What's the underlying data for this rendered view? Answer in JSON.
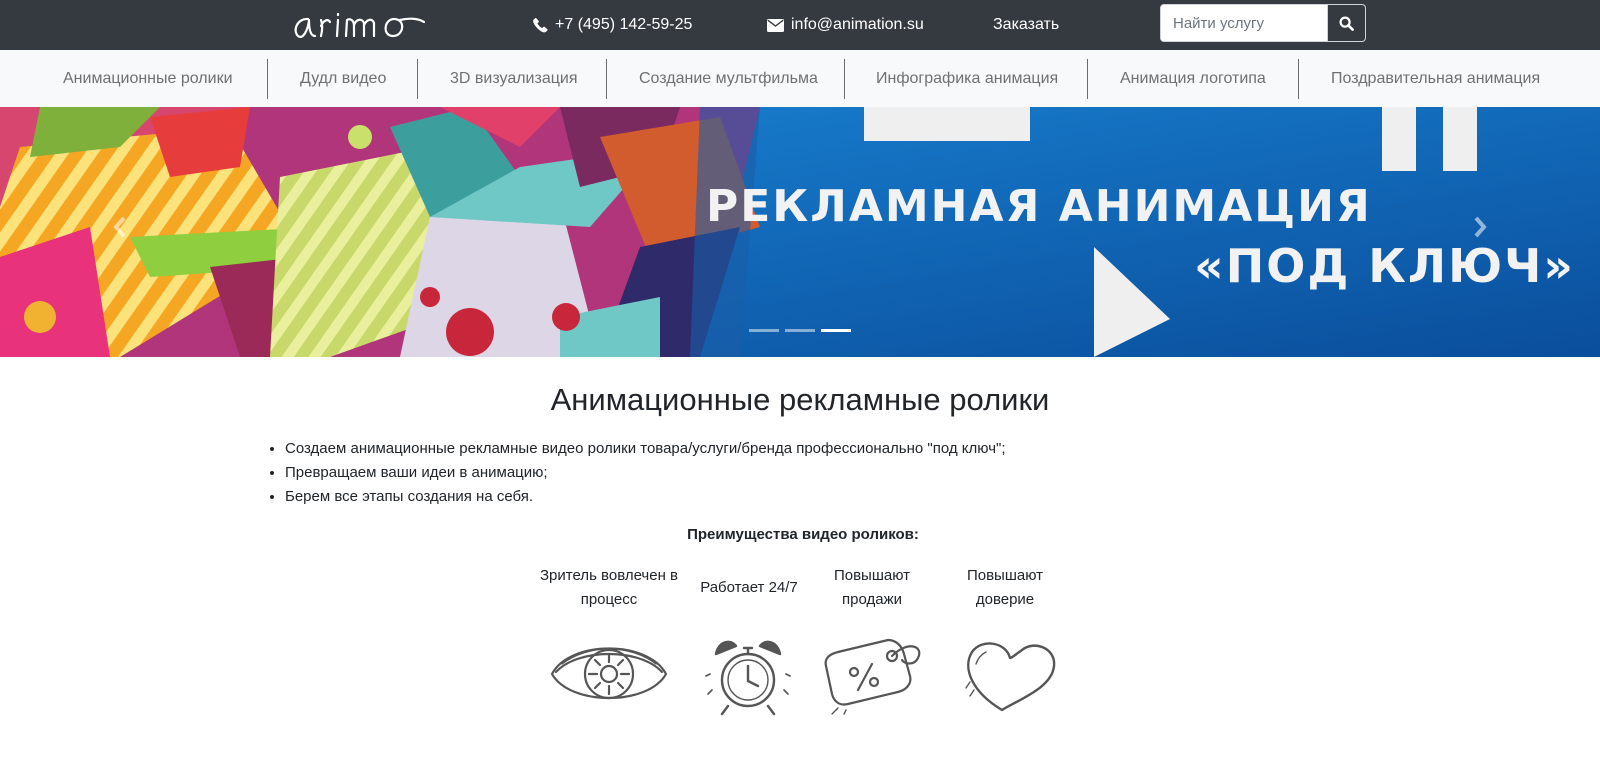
{
  "header": {
    "logo_text": "animo",
    "phone": "+7 (495) 142-59-25",
    "email": "info@animation.su",
    "order_link": "Заказать",
    "search_placeholder": "Найти услугу",
    "icons": {
      "phone": "phone-icon",
      "email": "envelope-icon",
      "search": "search-icon"
    }
  },
  "nav": {
    "items": [
      "Анимационные ролики",
      "Дудл видео",
      "3D визуализация",
      "Создание мультфильма",
      "Инфографика анимация",
      "Анимация логотипа",
      "Поздравительная анимация"
    ]
  },
  "carousel": {
    "line1": "РЕКЛАМНАЯ АНИМАЦИЯ",
    "line2": "«ПОД КЛЮЧ»",
    "slide_count": 3,
    "active_slide": 3,
    "colors": {
      "blue": "#0b5fb0",
      "text": "#f2f2f2"
    }
  },
  "main": {
    "title": "Анимационные рекламные ролики",
    "bullets": [
      "Создаем анимационные рекламные видео ролики товара/услуги/бренда профессионально \"под ключ\";",
      "Превращаем ваши идеи в анимацию;",
      "Берем все этапы создания на себя."
    ],
    "advantages_heading": "Преимущества видео роликов:",
    "advantages": [
      {
        "line1": "Зритель вовлечен в",
        "line2": "процесс",
        "icon": "eye-icon"
      },
      {
        "line1": "Работает 24/7",
        "line2": "",
        "icon": "alarm-clock-icon"
      },
      {
        "line1": "Повышают",
        "line2": "продажи",
        "icon": "discount-tag-icon"
      },
      {
        "line1": "Повышают",
        "line2": "доверие",
        "icon": "heart-icon"
      }
    ]
  }
}
